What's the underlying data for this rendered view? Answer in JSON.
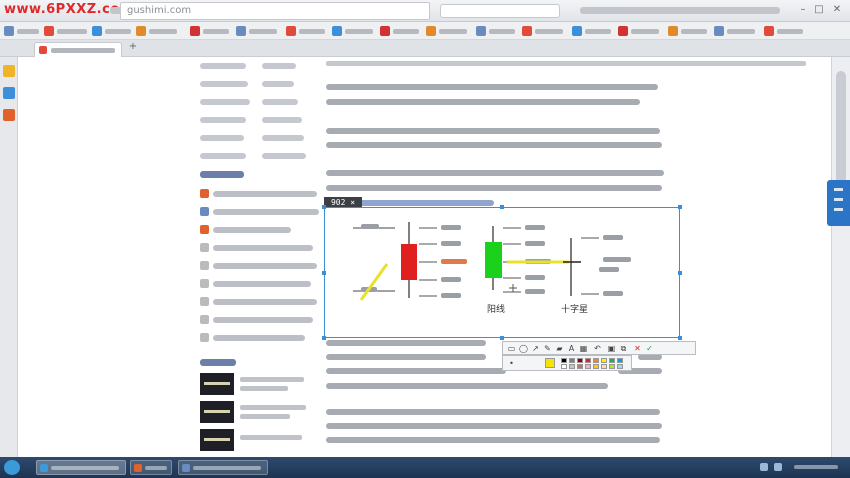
{
  "browser": {
    "watermark": "www.6PXXZ.com",
    "address": "gushimi.com"
  },
  "article": {
    "selection_size": "902 × 299"
  },
  "chart_data": {
    "type": "diagram",
    "candles": [
      {
        "name": "",
        "color": "#e01f1f"
      },
      {
        "name": "阳线",
        "color": "#1cd11c"
      },
      {
        "name": "十字星",
        "color": "#222222"
      }
    ]
  },
  "colors": {
    "watermark": "#e0282a",
    "selection": "#3a8fd8",
    "bear_candle": "#e01f1f",
    "bull_candle": "#1cd11c",
    "taskbar": "#1d3452"
  }
}
